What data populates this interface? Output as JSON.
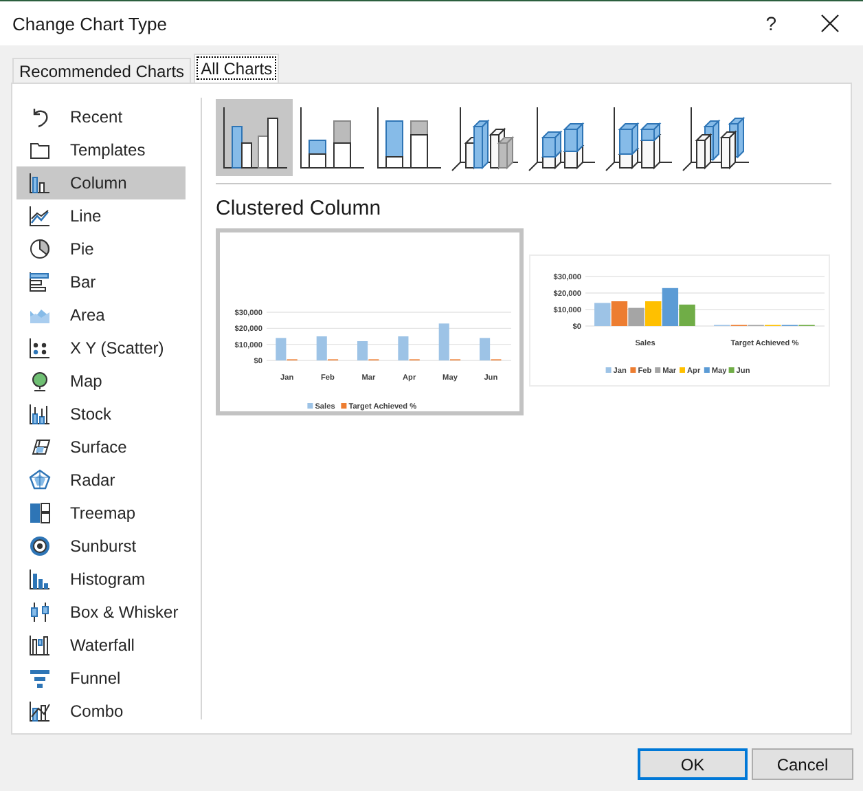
{
  "window": {
    "title": "Change Chart Type",
    "help": "?"
  },
  "tabs": [
    {
      "label": "Recommended Charts",
      "selected": false
    },
    {
      "label": "All Charts",
      "selected": true
    }
  ],
  "sidebar": {
    "items": [
      {
        "label": "Recent",
        "selected": false
      },
      {
        "label": "Templates",
        "selected": false
      },
      {
        "label": "Column",
        "selected": true
      },
      {
        "label": "Line",
        "selected": false
      },
      {
        "label": "Pie",
        "selected": false
      },
      {
        "label": "Bar",
        "selected": false
      },
      {
        "label": "Area",
        "selected": false
      },
      {
        "label": "X Y (Scatter)",
        "selected": false
      },
      {
        "label": "Map",
        "selected": false
      },
      {
        "label": "Stock",
        "selected": false
      },
      {
        "label": "Surface",
        "selected": false
      },
      {
        "label": "Radar",
        "selected": false
      },
      {
        "label": "Treemap",
        "selected": false
      },
      {
        "label": "Sunburst",
        "selected": false
      },
      {
        "label": "Histogram",
        "selected": false
      },
      {
        "label": "Box & Whisker",
        "selected": false
      },
      {
        "label": "Waterfall",
        "selected": false
      },
      {
        "label": "Funnel",
        "selected": false
      },
      {
        "label": "Combo",
        "selected": false
      }
    ]
  },
  "subtypes": [
    {
      "selected": true
    },
    {
      "selected": false
    },
    {
      "selected": false
    },
    {
      "selected": false
    },
    {
      "selected": false
    },
    {
      "selected": false
    },
    {
      "selected": false
    }
  ],
  "subtype_title": "Clustered Column",
  "previews": [
    {
      "selected": true,
      "chart_data": {
        "type": "bar",
        "categories": [
          "Jan",
          "Feb",
          "Mar",
          "Apr",
          "May",
          "Jun"
        ],
        "series": [
          {
            "name": "Sales",
            "color": "#9dc3e6",
            "values": [
              14000,
              15000,
              12000,
              15000,
              23000,
              14000
            ]
          },
          {
            "name": "Target Achieved %",
            "color": "#ed7d31",
            "values": [
              0,
              0,
              0,
              0,
              0,
              0
            ]
          }
        ],
        "ylim": [
          0,
          30000
        ],
        "yticks": [
          {
            "value": 0,
            "label": "$0"
          },
          {
            "value": 10000,
            "label": "$10,000"
          },
          {
            "value": 20000,
            "label": "$20,000"
          },
          {
            "value": 30000,
            "label": "$30,000"
          }
        ],
        "legend": "bottom"
      }
    },
    {
      "selected": false,
      "chart_data": {
        "type": "bar",
        "categories": [
          "Sales",
          "Target Achieved %"
        ],
        "series": [
          {
            "name": "Jan",
            "color": "#9dc3e6",
            "values": [
              14000,
              0
            ]
          },
          {
            "name": "Feb",
            "color": "#ed7d31",
            "values": [
              15000,
              0
            ]
          },
          {
            "name": "Mar",
            "color": "#a5a5a5",
            "values": [
              11000,
              0
            ]
          },
          {
            "name": "Apr",
            "color": "#ffc000",
            "values": [
              15000,
              0
            ]
          },
          {
            "name": "May",
            "color": "#5b9bd5",
            "values": [
              23000,
              0
            ]
          },
          {
            "name": "Jun",
            "color": "#70ad47",
            "values": [
              13000,
              0
            ]
          }
        ],
        "ylim": [
          0,
          30000
        ],
        "yticks": [
          {
            "value": 0,
            "label": "$0"
          },
          {
            "value": 10000,
            "label": "$10,000"
          },
          {
            "value": 20000,
            "label": "$20,000"
          },
          {
            "value": 30000,
            "label": "$30,000"
          }
        ],
        "legend": "bottom"
      }
    }
  ],
  "buttons": [
    {
      "label": "OK",
      "default": true
    },
    {
      "label": "Cancel",
      "default": false
    }
  ]
}
